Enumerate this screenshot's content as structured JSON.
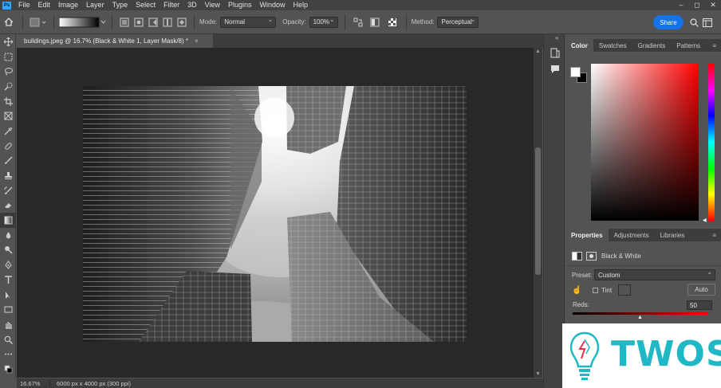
{
  "app": {
    "logo_text": "Ps"
  },
  "menu": [
    "File",
    "Edit",
    "Image",
    "Layer",
    "Type",
    "Select",
    "Filter",
    "3D",
    "View",
    "Plugins",
    "Window",
    "Help"
  ],
  "window_controls": {
    "minimize": "–",
    "maximize": "◻",
    "close": "✕"
  },
  "options_bar": {
    "mode_label": "Mode:",
    "mode_value": "Normal",
    "opacity_label": "Opacity:",
    "opacity_value": "100%",
    "method_label": "Method:",
    "method_value": "Perceptual",
    "share_label": "Share"
  },
  "document_tab": {
    "title": "buildings.jpeg @ 16.7% (Black & White 1, Layer Mask/8) *",
    "close": "×"
  },
  "status_bar": {
    "zoom": "16.67%",
    "dimensions": "6000 px x 4000 px (300 ppi)"
  },
  "color_panel": {
    "tabs": [
      "Color",
      "Swatches",
      "Gradients",
      "Patterns"
    ],
    "active_tab": "Color",
    "foreground": "#ffffff",
    "background": "#000000",
    "hue": "#ff0000"
  },
  "properties_panel": {
    "tabs": [
      "Properties",
      "Adjustments",
      "Libraries"
    ],
    "active_tab": "Properties",
    "adjustment_name": "Black & White",
    "preset_label": "Preset:",
    "preset_value": "Custom",
    "tint_label": "Tint",
    "auto_label": "Auto",
    "reds_label": "Reds:",
    "reds_value": "50",
    "reds_fraction": 0.5
  },
  "watermark": {
    "text": "TWOS"
  },
  "colors": {
    "accent": "#1473e6",
    "panel": "#535353",
    "canvas_bg": "#282828",
    "watermark": "#21b8c5"
  }
}
